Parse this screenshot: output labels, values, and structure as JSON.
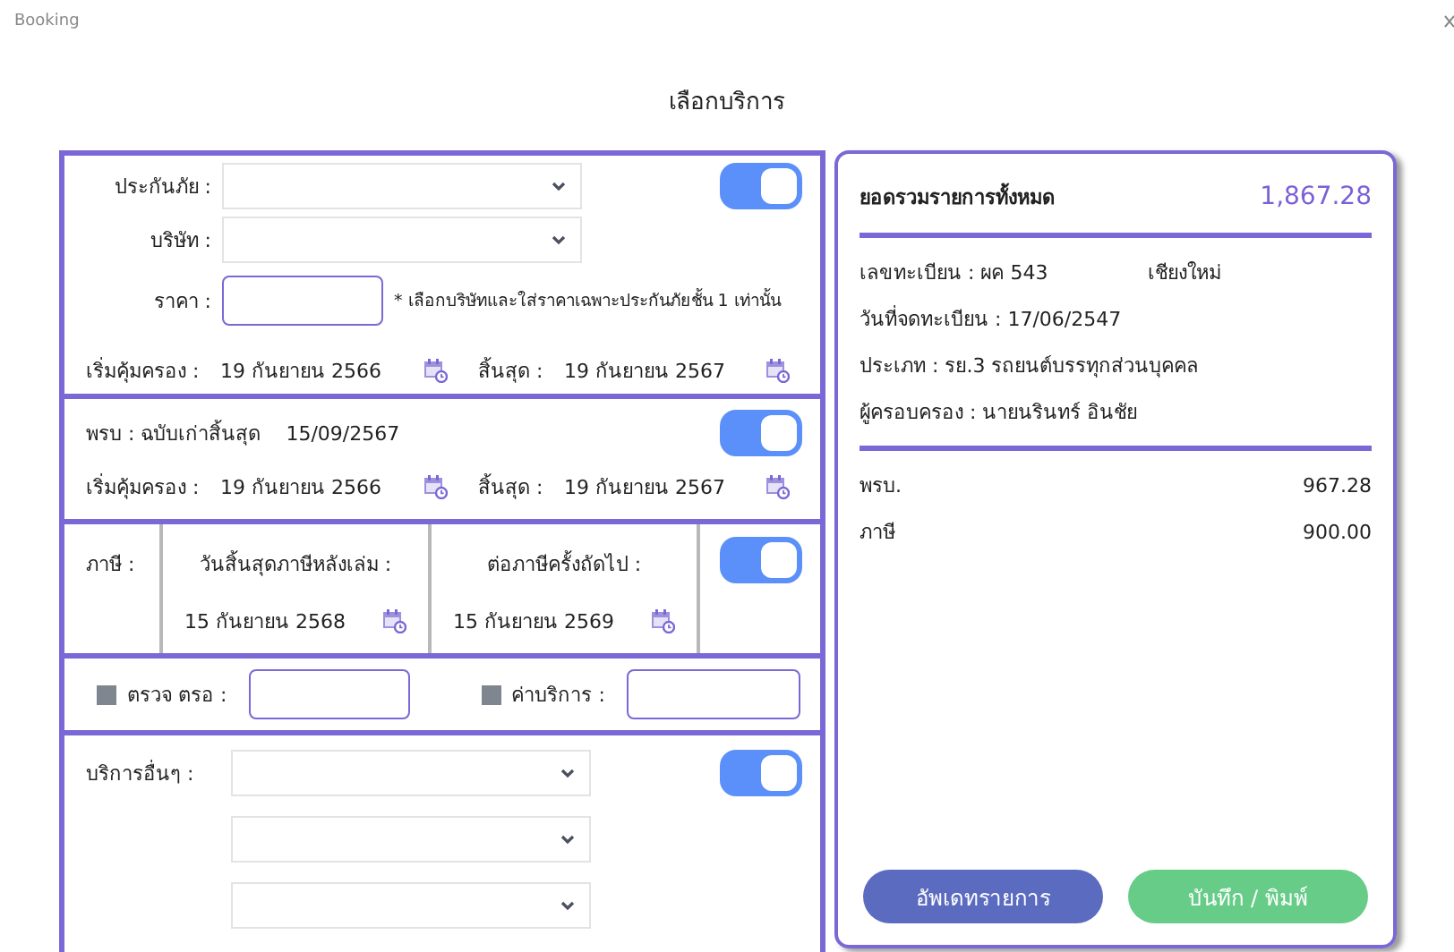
{
  "window": {
    "title": "Booking"
  },
  "heading": "เลือกบริการ",
  "insurance": {
    "enabled": true,
    "type_label": "ประกันภัย :",
    "company_label": "บริษัท :",
    "price_label": "ราคา :",
    "note": "* เลือกบริษัทและใส่ราคาเฉพาะประกันภัยชั้น 1 เท่านั้น",
    "start_label": "เริ่มคุ้มครอง :",
    "start_date": "19 กันยายน 2566",
    "end_label": "สิ้นสุด :",
    "end_date": "19 กันยายน 2567"
  },
  "compulsory": {
    "enabled": true,
    "title": "พรบ : ฉบับเก่าสิ้นสุด",
    "old_expiry": "15/09/2567",
    "start_label": "เริ่มคุ้มครอง :",
    "start_date": "19 กันยายน 2566",
    "end_label": "สิ้นสุด :",
    "end_date": "19 กันยายน 2567"
  },
  "tax": {
    "enabled": true,
    "label": "ภาษี :",
    "expiry_label": "วันสิ้นสุดภาษีหลังเล่ม :",
    "expiry_date": "15 กันยายน 2568",
    "next_label": "ต่อภาษีครั้งถัดไป :",
    "next_date": "15 กันยายน 2569"
  },
  "extras": [
    {
      "label": "ตรวจ ตรอ :",
      "checked": false
    },
    {
      "label": "ค่าบริการ :",
      "checked": false
    }
  ],
  "other_services": {
    "enabled": true,
    "label": "บริการอื่นๆ :"
  },
  "summary": {
    "total_label": "ยอดรวมรายการทั้งหมด",
    "total": "1,867.28",
    "details": [
      {
        "text": "เลขทะเบียน : ผค 543",
        "extra": "เชียงใหม่"
      },
      {
        "text": "วันที่จดทะเบียน : 17/06/2547"
      },
      {
        "text": "ประเภท : รย.3 รถยนต์บรรทุกส่วนบุคคล"
      },
      {
        "text": "ผู้ครอบครอง : นายนรินทร์ อินชัย"
      }
    ],
    "items": [
      {
        "label": "พรบ.",
        "amount": "967.28"
      },
      {
        "label": "ภาษี",
        "amount": "900.00"
      }
    ],
    "buttons": [
      {
        "label": "อัพเดทรายการ",
        "kind": "update"
      },
      {
        "label": "บันทึก / พิมพ์",
        "kind": "save"
      }
    ]
  }
}
